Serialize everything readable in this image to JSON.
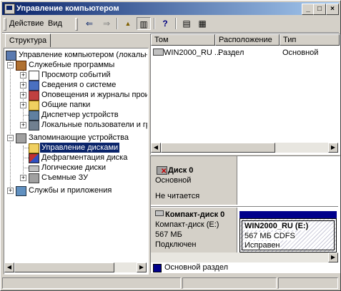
{
  "window": {
    "title": "Управление компьютером",
    "min_glyph": "_",
    "max_glyph": "□",
    "close_glyph": "×"
  },
  "menu": {
    "action_label": "Действие",
    "view_label": "Вид"
  },
  "toolbar": {
    "back_glyph": "⇐",
    "forward_glyph": "⇒",
    "up_glyph": "▲",
    "show_tree_glyph": "▥",
    "help_glyph": "?",
    "properties_glyph": "▤",
    "refresh_glyph": "▦"
  },
  "left_tab": {
    "label": "Структура"
  },
  "tree": {
    "root": "Управление компьютером (локальным",
    "system_tools": "Служебные программы",
    "event_viewer": "Просмотр событий",
    "system_info": "Сведения о системе",
    "alerts": "Оповещения и журналы произв",
    "shared_folders": "Общие папки",
    "device_manager": "Диспетчер устройств",
    "local_users": "Локальные пользователи и гру",
    "storage": "Запоминающие устройства",
    "disk_management": "Управление дисками",
    "defrag": "Дефрагментация диска",
    "logical_drives": "Логические диски",
    "removable": "Съемные ЗУ",
    "services": "Службы и приложения"
  },
  "volume_list": {
    "columns": [
      "Том",
      "Расположение",
      "Тип"
    ],
    "rows": [
      {
        "name": "WIN2000_RU ...",
        "location": "Раздел",
        "type": "Основной"
      }
    ]
  },
  "disks": {
    "disk0": {
      "title": "Диск 0",
      "type": "Основной",
      "status": "Не читается"
    },
    "cd0": {
      "title": "Компакт-диск 0",
      "drive": "Компакт-диск (E:)",
      "size": "567 МБ",
      "status": "Подключен",
      "volume": {
        "name": "WIN2000_RU (E:)",
        "size_fs": "567 МБ CDFS",
        "health": "Исправен"
      }
    }
  },
  "legend": {
    "label": "Основной раздел",
    "color": "#00008b"
  },
  "colors": {
    "title_gradient_start": "#0a246a",
    "title_gradient_end": "#a6caf0",
    "selection": "#0a246a",
    "face": "#d4d0c8"
  }
}
